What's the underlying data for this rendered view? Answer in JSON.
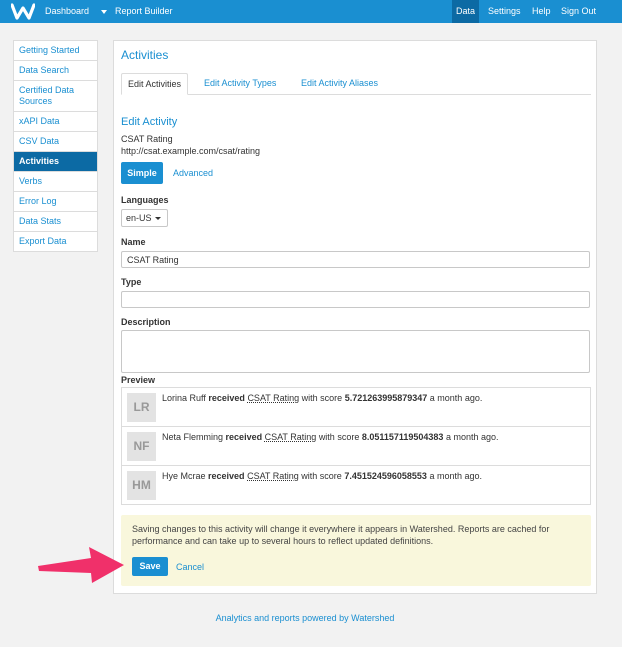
{
  "topbar": {
    "dashboard": "Dashboard",
    "report_builder": "Report Builder",
    "right": [
      "Data",
      "Settings",
      "Help",
      "Sign Out"
    ]
  },
  "sidebar": {
    "items": [
      "Getting Started",
      "Data Search",
      "Certified Data Sources",
      "xAPI Data",
      "CSV Data",
      "Activities",
      "Verbs",
      "Error Log",
      "Data Stats",
      "Export Data"
    ]
  },
  "main": {
    "title": "Activities",
    "tabs": [
      "Edit Activities",
      "Edit Activity Types",
      "Edit Activity Aliases"
    ],
    "section_title": "Edit Activity",
    "activity_name": "CSAT Rating",
    "activity_url": "http://csat.example.com/csat/rating",
    "mode_simple": "Simple",
    "mode_advanced": "Advanced",
    "languages_label": "Languages",
    "language_value": "en-US",
    "name_label": "Name",
    "name_value": "CSAT Rating",
    "type_label": "Type",
    "type_value": "",
    "description_label": "Description",
    "description_value": "",
    "preview_label": "Preview",
    "preview_rows": [
      {
        "initials": "LR",
        "name": "Lorina Ruff",
        "verb": "received",
        "activity": "CSAT Rating",
        "mid": "with score",
        "score": "5.721263995879347",
        "time": "a month ago."
      },
      {
        "initials": "NF",
        "name": "Neta Flemming",
        "verb": "received",
        "activity": "CSAT Rating",
        "mid": "with score",
        "score": "8.051157119504383",
        "time": "a month ago."
      },
      {
        "initials": "HM",
        "name": "Hye Mcrae",
        "verb": "received",
        "activity": "CSAT Rating",
        "mid": "with score",
        "score": "7.451524596058553",
        "time": "a month ago."
      }
    ],
    "notice": "Saving changes to this activity will change it everywhere it appears in Watershed. Reports are cached for performance and can take up to several hours to reflect updated definitions.",
    "save_label": "Save",
    "cancel_label": "Cancel"
  },
  "footer": "Analytics and reports powered by Watershed",
  "colors": {
    "brand": "#1a8fd1",
    "active": "#0c6aa4",
    "notice_bg": "#f9f7dc",
    "arrow": "#f0306a"
  }
}
